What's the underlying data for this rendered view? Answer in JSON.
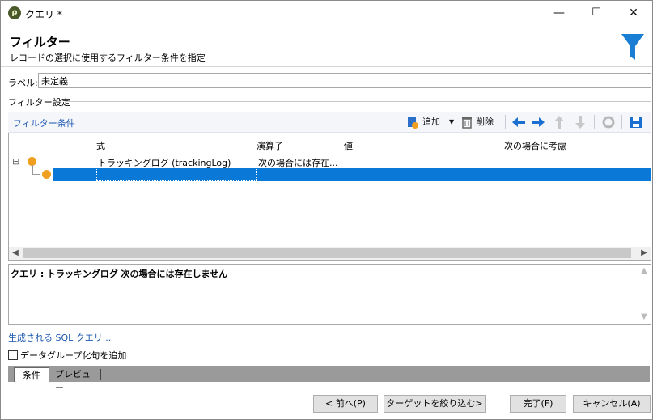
{
  "window": {
    "title": "クエリ *",
    "app_icon": "ρ",
    "minimize": "—",
    "maximize": "☐",
    "close": "✕"
  },
  "header": {
    "title": "フィルター",
    "subtitle": "レコードの選択に使用するフィルター条件を指定",
    "accent": "#1a7fd4"
  },
  "label_field": {
    "label": "ラベル:",
    "value": "未定義"
  },
  "section_title": "フィルター設定",
  "toolbar": {
    "conditions_label": "フィルター条件",
    "add_label": "追加",
    "delete_label": "削除"
  },
  "grid": {
    "columns": [
      "式",
      "演算子",
      "値",
      "次の場合に考慮"
    ],
    "rows": [
      {
        "expression": "トラッキングログ (trackingLog)",
        "operator": "次の場合には存在...",
        "value": "",
        "consider": ""
      },
      {
        "expression": "",
        "operator": "",
        "value": "",
        "consider": "",
        "selected": true
      }
    ],
    "tree_toggle": "⊟"
  },
  "description": "クエリ : トラッキングログ 次の場合には存在しません",
  "sql_link": "生成される SQL クエリ...",
  "checkbox": {
    "label": "データグループ化句を追加",
    "checked": false
  },
  "tabs": [
    {
      "label": "条件",
      "active": true
    },
    {
      "label": "プレビュー",
      "active": false
    }
  ],
  "buttons": {
    "prev": "< 前へ(P)",
    "narrow": "ターゲットを絞り込む>",
    "finish": "完了(F)",
    "cancel": "キャンセル(A)"
  }
}
